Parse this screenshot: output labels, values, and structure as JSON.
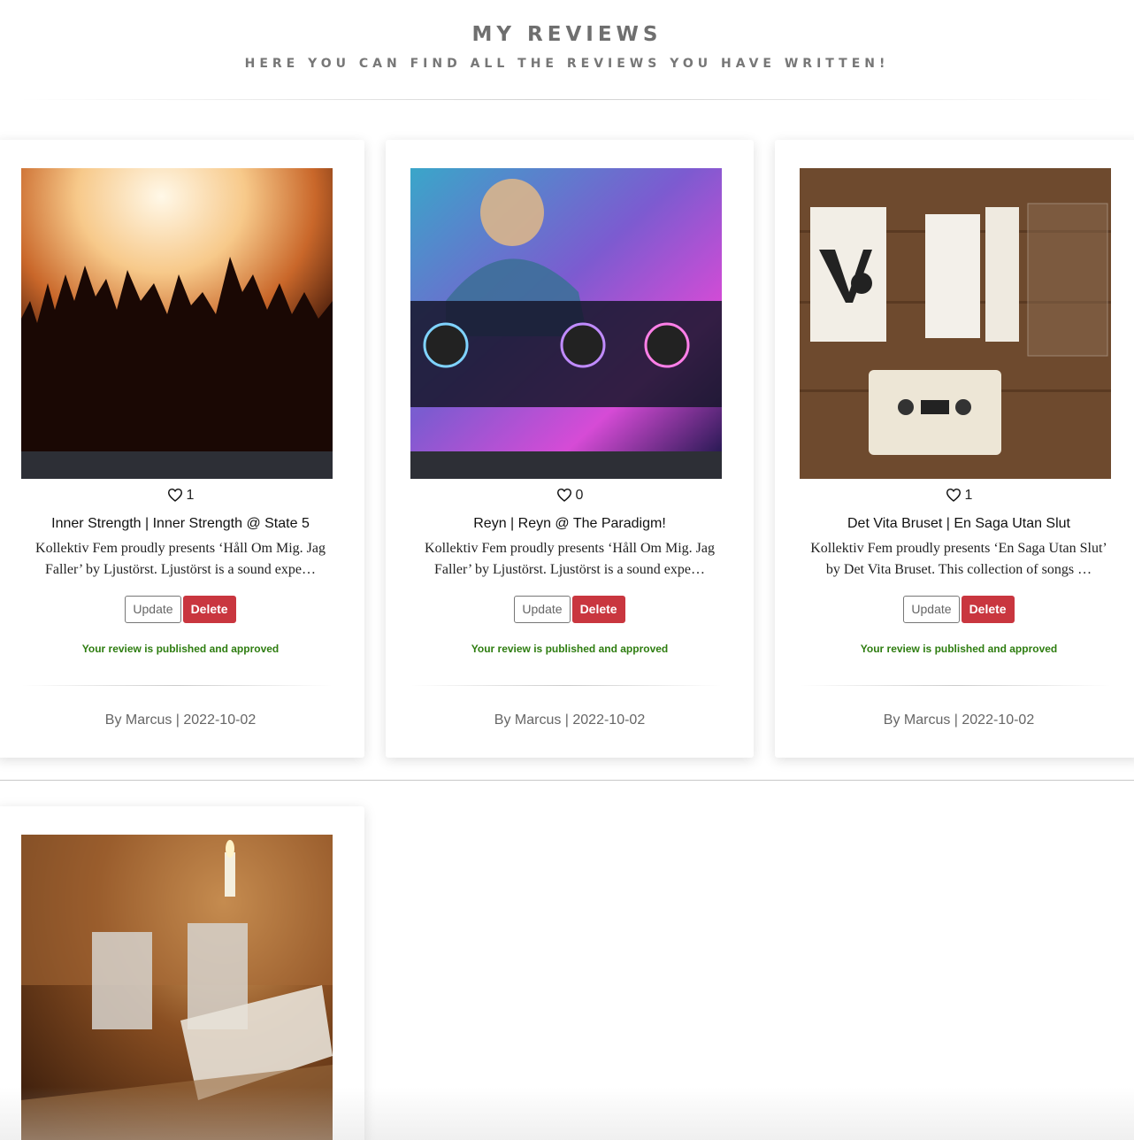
{
  "header": {
    "title": "MY REVIEWS",
    "subtitle": "HERE YOU CAN FIND ALL THE REVIEWS YOU HAVE WRITTEN!"
  },
  "reviews": [
    {
      "likes": "1",
      "title": "Inner Strength | Inner Strength @ State 5",
      "excerpt": "Kollektiv Fem proudly presents ‘Håll Om Mig. Jag Faller’ by Ljustörst. Ljustörst is a sound expe…",
      "update_label": "Update",
      "delete_label": "Delete",
      "status": "Your review is published and approved",
      "byline": "By Marcus | 2022-10-02",
      "image_icon": "concert-crowd-image"
    },
    {
      "likes": "0",
      "title": "Reyn | Reyn @ The Paradigm!",
      "excerpt": "Kollektiv Fem proudly presents ‘Håll Om Mig. Jag Faller’ by Ljustörst. Ljustörst is a sound expe…",
      "update_label": "Update",
      "delete_label": "Delete",
      "status": "Your review is published and approved",
      "byline": "By Marcus | 2022-10-02",
      "image_icon": "dj-mixer-image"
    },
    {
      "likes": "1",
      "title": "Det Vita Bruset | En Saga Utan Slut",
      "excerpt": "Kollektiv Fem proudly presents ‘En Saga Utan Slut’ by Det Vita Bruset. This collection of songs …",
      "update_label": "Update",
      "delete_label": "Delete",
      "status": "Your review is published and approved",
      "byline": "By Marcus | 2022-10-02",
      "image_icon": "cassette-tape-image"
    },
    {
      "image_icon": "cassette-candle-image"
    }
  ],
  "colors": {
    "delete": "#c9363f",
    "approved": "#2e7d10",
    "muted": "#666666"
  }
}
